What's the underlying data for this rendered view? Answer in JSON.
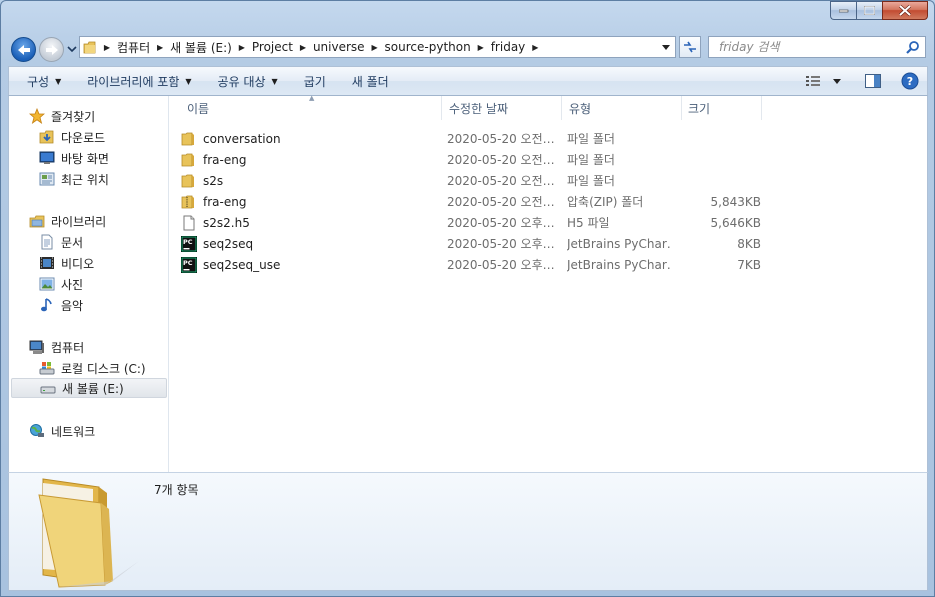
{
  "window": {
    "caption_buttons": [
      "minimize",
      "maximize",
      "close"
    ]
  },
  "address_bar": {
    "breadcrumbs": [
      "컴퓨터",
      "새 볼륨 (E:)",
      "Project",
      "universe",
      "source-python",
      "friday"
    ]
  },
  "search": {
    "placeholder": "friday 검색"
  },
  "command_bar": {
    "organize": "구성",
    "include_in_library": "라이브러리에 포함",
    "share_with": "공유 대상",
    "burn": "굽기",
    "new_folder": "새 폴더"
  },
  "sidebar": {
    "favorites": {
      "label": "즐겨찾기",
      "items": [
        {
          "label": "다운로드",
          "icon": "download-folder-icon"
        },
        {
          "label": "바탕 화면",
          "icon": "desktop-icon"
        },
        {
          "label": "최근 위치",
          "icon": "recent-places-icon"
        }
      ]
    },
    "libraries": {
      "label": "라이브러리",
      "items": [
        {
          "label": "문서",
          "icon": "documents-icon"
        },
        {
          "label": "비디오",
          "icon": "videos-icon"
        },
        {
          "label": "사진",
          "icon": "pictures-icon"
        },
        {
          "label": "음악",
          "icon": "music-icon"
        }
      ]
    },
    "computer": {
      "label": "컴퓨터",
      "items": [
        {
          "label": "로컬 디스크 (C:)",
          "icon": "local-disk-icon"
        },
        {
          "label": "새 볼륨 (E:)",
          "icon": "drive-icon",
          "selected": true
        }
      ]
    },
    "network": {
      "label": "네트워크"
    }
  },
  "columns": {
    "name": "이름",
    "date": "수정한 날짜",
    "type": "유형",
    "size": "크기"
  },
  "files": [
    {
      "name": "conversation",
      "date": "2020-05-20 오전…",
      "type": "파일 폴더",
      "size": "",
      "icon": "folder-icon"
    },
    {
      "name": "fra-eng",
      "date": "2020-05-20 오전…",
      "type": "파일 폴더",
      "size": "",
      "icon": "folder-icon"
    },
    {
      "name": "s2s",
      "date": "2020-05-20 오전…",
      "type": "파일 폴더",
      "size": "",
      "icon": "folder-icon"
    },
    {
      "name": "fra-eng",
      "date": "2020-05-20 오전…",
      "type": "압축(ZIP) 폴더",
      "size": "5,843KB",
      "icon": "zip-folder-icon"
    },
    {
      "name": "s2s2.h5",
      "date": "2020-05-20 오후…",
      "type": "H5 파일",
      "size": "5,646KB",
      "icon": "file-icon"
    },
    {
      "name": "seq2seq",
      "date": "2020-05-20 오후…",
      "type": "JetBrains PyChar…",
      "size": "8KB",
      "icon": "pycharm-icon"
    },
    {
      "name": "seq2seq_use",
      "date": "2020-05-20 오후…",
      "type": "JetBrains PyChar…",
      "size": "7KB",
      "icon": "pycharm-icon"
    }
  ],
  "details": {
    "item_count": "7개 항목"
  },
  "colors": {
    "accent": "#1a5fb8",
    "folder": "#e8c35a",
    "window_frame": "#b9d1ea"
  }
}
